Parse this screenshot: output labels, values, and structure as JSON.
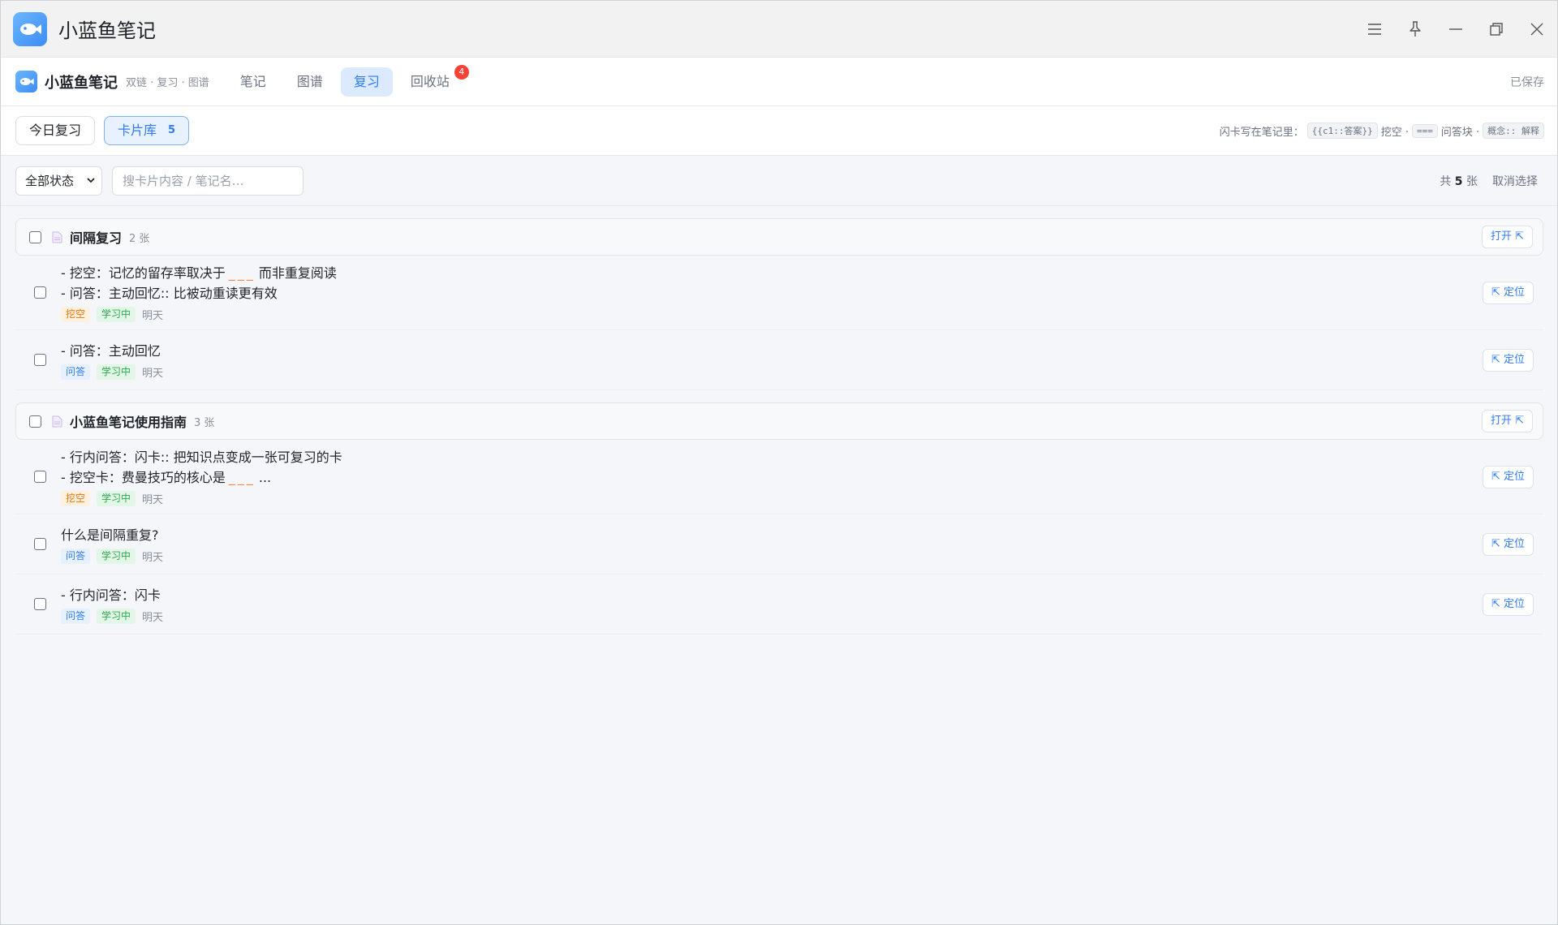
{
  "window": {
    "title": "小蓝鱼笔记",
    "controls": [
      "menu-icon",
      "pin-icon",
      "minimize-icon",
      "restore-icon",
      "close-icon"
    ]
  },
  "nav": {
    "brand": "小蓝鱼笔记",
    "brand_sub": "双链 · 复习 · 图谱",
    "tabs": [
      {
        "label": "笔记",
        "active": false
      },
      {
        "label": "图谱",
        "active": false
      },
      {
        "label": "复习",
        "active": true
      },
      {
        "label": "回收站",
        "active": false,
        "badge": "4"
      }
    ],
    "saved": "已保存"
  },
  "subbar": {
    "tabs": [
      {
        "label": "今日复习",
        "active": false
      },
      {
        "label": "卡片库",
        "count": "5",
        "active": true
      }
    ],
    "hint": {
      "prefix": "闪卡写在笔记里：",
      "code1": "{{c1::答案}}",
      "text1": "挖空 ·",
      "code2": "===",
      "text2": "问答块 ·",
      "code3": "概念:: 解释"
    }
  },
  "filter": {
    "status_select": "全部状态",
    "search_placeholder": "搜卡片内容 / 笔记名…",
    "total_prefix": "共",
    "total_count": "5",
    "total_suffix": "张",
    "deselect": "取消选择"
  },
  "groups": [
    {
      "title": "间隔复习",
      "count": "2 张",
      "open_label": "打开 ⇱",
      "cards": [
        {
          "line1_pre": "- 挖空：记忆的留存率取决于",
          "line1_blank": "___",
          "line1_post": "而非重复阅读",
          "line2": "- 问答：主动回忆:: 比被动重读更有效",
          "type": "挖空",
          "status": "学习中",
          "due": "明天",
          "locate": "⇱ 定位"
        },
        {
          "line1_pre": "- 问答：主动回忆",
          "type": "问答",
          "status": "学习中",
          "due": "明天",
          "locate": "⇱ 定位"
        }
      ]
    },
    {
      "title": "小蓝鱼笔记使用指南",
      "count": "3 张",
      "open_label": "打开 ⇱",
      "cards": [
        {
          "line1_pre": "- 行内问答：闪卡:: 把知识点变成一张可复习的卡",
          "line2_pre": "- 挖空卡：费曼技巧的核心是",
          "line2_blank": "___",
          "line2_post": "...",
          "type": "挖空",
          "status": "学习中",
          "due": "明天",
          "locate": "⇱ 定位"
        },
        {
          "line1_pre": "什么是间隔重复?",
          "type": "问答",
          "status": "学习中",
          "due": "明天",
          "locate": "⇱ 定位"
        },
        {
          "line1_pre": "- 行内问答：闪卡",
          "type": "问答",
          "status": "学习中",
          "due": "明天",
          "locate": "⇱ 定位"
        }
      ]
    }
  ]
}
